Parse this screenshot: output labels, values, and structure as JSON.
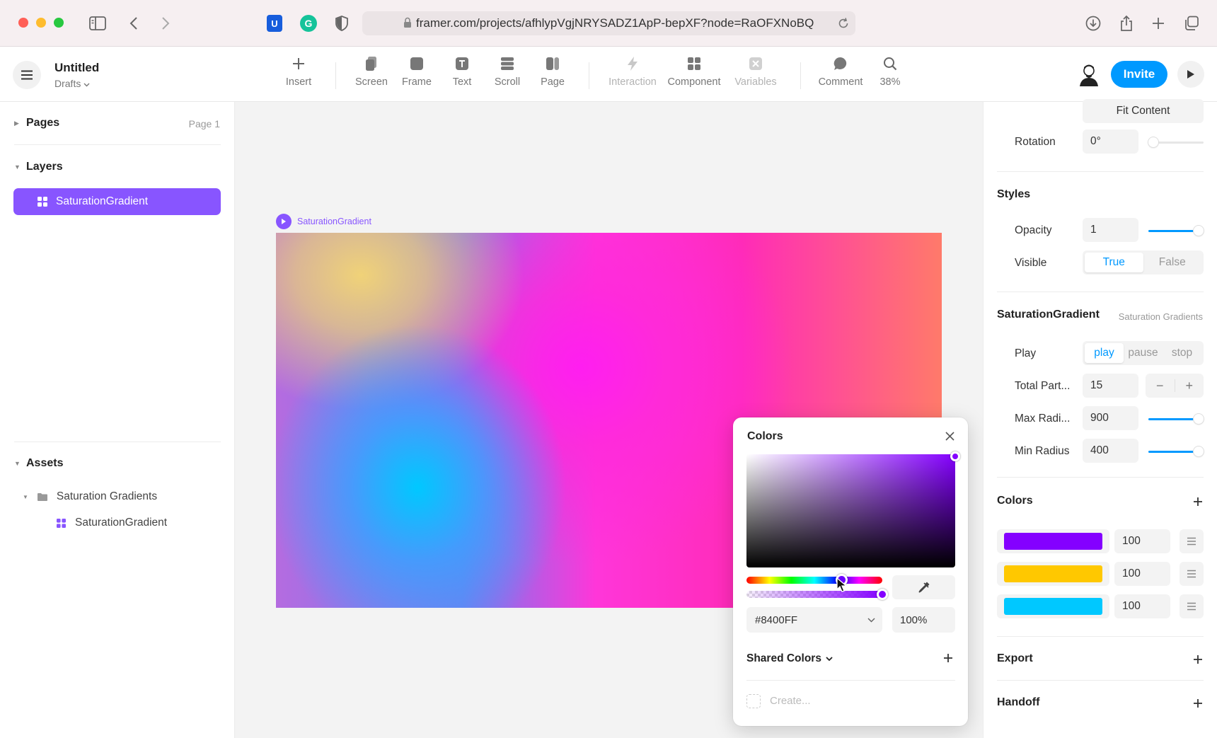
{
  "browser": {
    "url": "framer.com/projects/afhlypVgjNRYSADZ1ApP-bepXF?node=RaOFXNoBQ"
  },
  "app": {
    "doc_title": "Untitled",
    "doc_location": "Drafts",
    "tools": [
      {
        "label": "Insert",
        "icon": "plus-icon"
      },
      {
        "label": "Screen",
        "icon": "screen-icon"
      },
      {
        "label": "Frame",
        "icon": "frame-icon"
      },
      {
        "label": "Text",
        "icon": "text-icon"
      },
      {
        "label": "Scroll",
        "icon": "scroll-icon"
      },
      {
        "label": "Page",
        "icon": "page-icon"
      },
      {
        "label": "Interaction",
        "icon": "bolt-icon"
      },
      {
        "label": "Component",
        "icon": "component-icon"
      },
      {
        "label": "Variables",
        "icon": "variables-icon"
      },
      {
        "label": "Comment",
        "icon": "comment-icon"
      },
      {
        "label": "38%",
        "icon": "search-icon"
      }
    ],
    "invite_label": "Invite"
  },
  "left_panel": {
    "pages": {
      "title": "Pages",
      "current": "Page 1"
    },
    "layers": {
      "title": "Layers",
      "items": [
        "SaturationGradient"
      ]
    },
    "assets": {
      "title": "Assets",
      "folder": "Saturation Gradients",
      "items": [
        "SaturationGradient"
      ]
    }
  },
  "canvas": {
    "frame_label": "SaturationGradient"
  },
  "color_picker": {
    "title": "Colors",
    "hex": "#8400FF",
    "alpha": "100%",
    "hue_position": 0.7,
    "alpha_position": 1.0,
    "shared_title": "Shared Colors",
    "create_placeholder": "Create..."
  },
  "right_panel": {
    "fit_content": "Fit Content",
    "rotation": {
      "label": "Rotation",
      "value": "0°"
    },
    "styles": {
      "title": "Styles",
      "opacity": {
        "label": "Opacity",
        "value": "1"
      },
      "visible": {
        "label": "Visible",
        "options": [
          "True",
          "False"
        ],
        "selected": "True"
      }
    },
    "component": {
      "title": "SaturationGradient",
      "meta": "Saturation Gradients",
      "play": {
        "label": "Play",
        "options": [
          "play",
          "pause",
          "stop"
        ],
        "selected": "play"
      },
      "total_particles": {
        "label": "Total Part...",
        "value": "15"
      },
      "max_radius": {
        "label": "Max Radi...",
        "value": "900"
      },
      "min_radius": {
        "label": "Min Radius",
        "value": "400"
      }
    },
    "colors": {
      "title": "Colors",
      "rows": [
        {
          "color": "#8400FF",
          "value": "100"
        },
        {
          "color": "#FFC800",
          "value": "100"
        },
        {
          "color": "#00C8FF",
          "value": "100"
        }
      ]
    },
    "export_title": "Export",
    "handoff_title": "Handoff"
  }
}
